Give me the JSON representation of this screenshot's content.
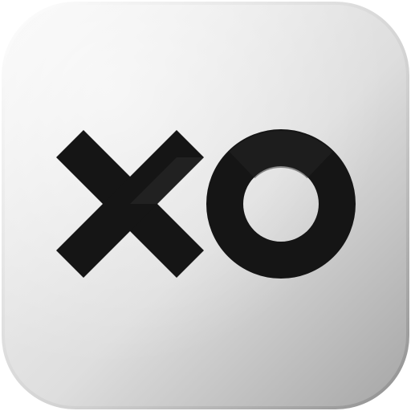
{
  "icon": {
    "name": "XO",
    "glyphs": [
      "x-mark",
      "o-mark"
    ],
    "colors": {
      "background_light": "#f5f5f5",
      "background_mid": "#dcdcdc",
      "background_dark": "#a9a9a9",
      "border": "#c9c9c9",
      "mark_dark": "#151515",
      "mark_shade": "#262626"
    }
  }
}
